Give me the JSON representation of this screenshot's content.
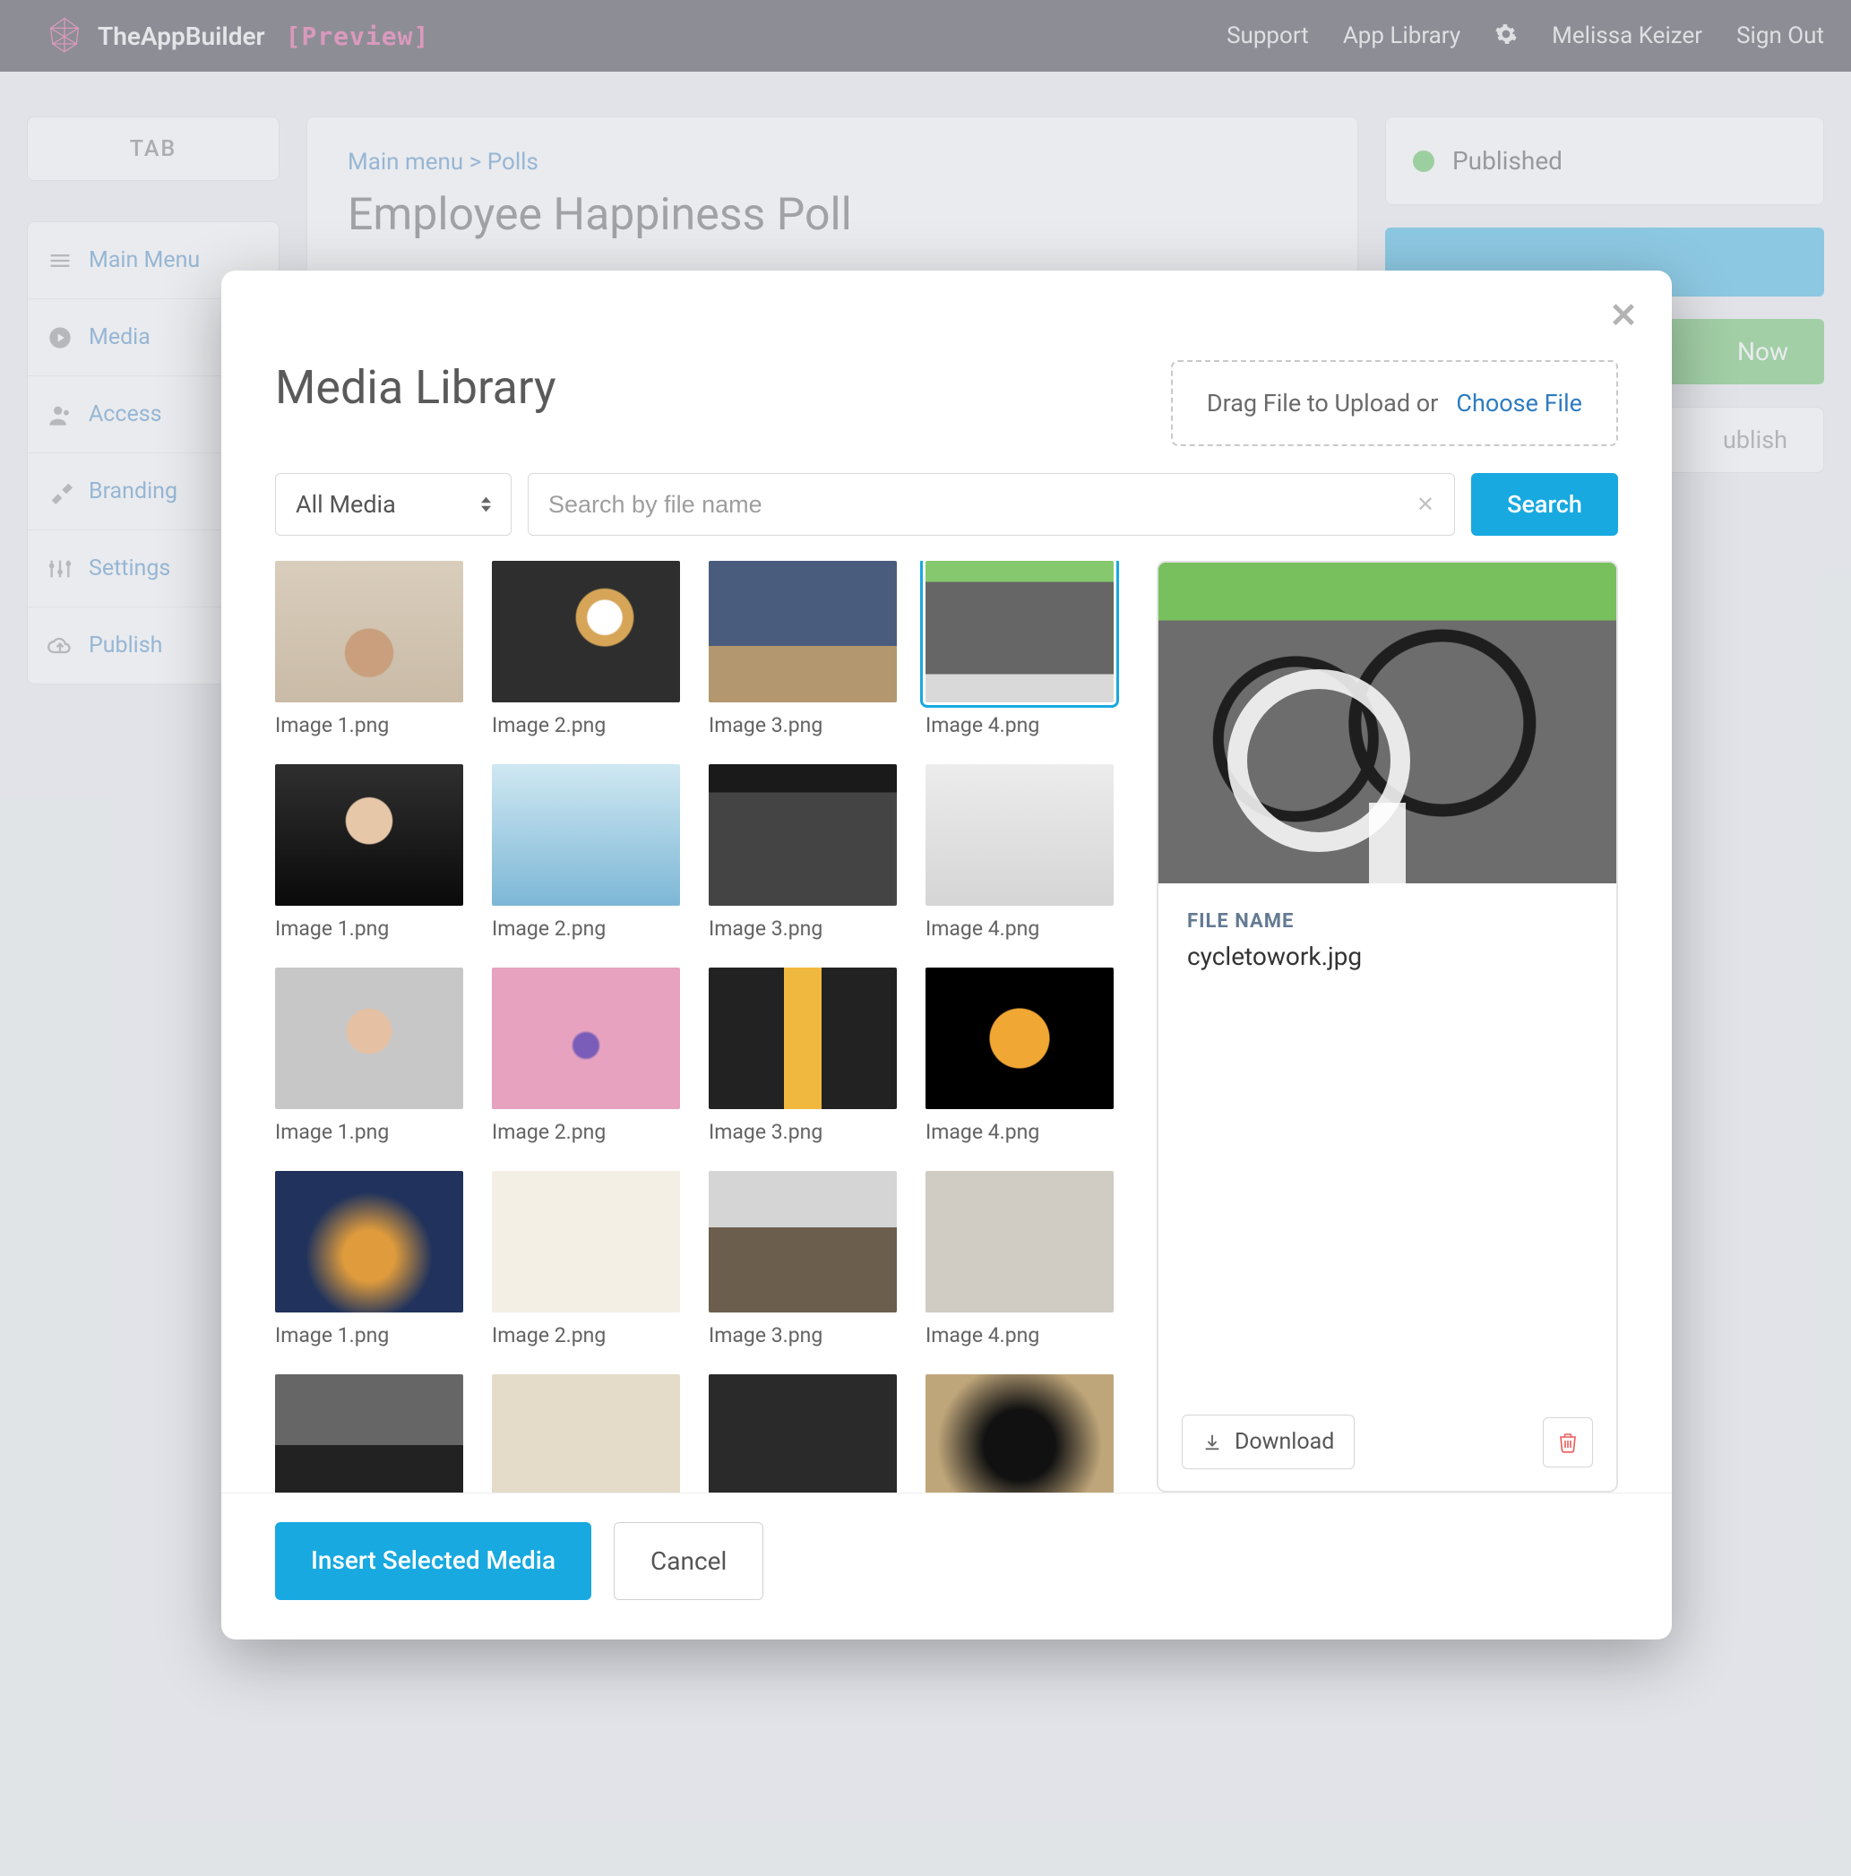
{
  "header": {
    "brand": "TheAppBuilder",
    "preview_tag": "[Preview]",
    "nav": {
      "support": "Support",
      "app_library": "App Library",
      "user_name": "Melissa Keizer",
      "sign_out": "Sign Out"
    }
  },
  "sidebar": {
    "tab_label": "TAB",
    "items": [
      {
        "label": "Main Menu",
        "icon": "menu-icon"
      },
      {
        "label": "Media",
        "icon": "play-icon"
      },
      {
        "label": "Access",
        "icon": "person-icon"
      },
      {
        "label": "Branding",
        "icon": "brush-icon"
      },
      {
        "label": "Settings",
        "icon": "sliders-icon"
      },
      {
        "label": "Publish",
        "icon": "cloud-icon"
      }
    ]
  },
  "main": {
    "breadcrumb_root": "Main menu",
    "breadcrumb_sep": ">",
    "breadcrumb_leaf": "Polls",
    "title": "Employee Happiness Poll"
  },
  "right": {
    "status": "Published",
    "btn_now_fragment": "Now",
    "unpublish_fragment": "ublish"
  },
  "modal": {
    "title": "Media Library",
    "upload_prefix": "Drag File to Upload or",
    "upload_choose": "Choose File",
    "filter_selected": "All Media",
    "search_placeholder": "Search by file name",
    "search_btn": "Search",
    "insert_btn": "Insert Selected Media",
    "cancel_btn": "Cancel",
    "detail": {
      "label": "FILE NAME",
      "filename": "cycletowork.jpg",
      "download": "Download"
    },
    "grid": [
      [
        {
          "caption": "Image 1.png",
          "art": "th-1"
        },
        {
          "caption": "Image 2.png",
          "art": "th-2"
        },
        {
          "caption": "Image 3.png",
          "art": "th-3"
        },
        {
          "caption": "Image 4.png",
          "art": "th-4",
          "selected": true
        }
      ],
      [
        {
          "caption": "Image 1.png",
          "art": "th-5"
        },
        {
          "caption": "Image 2.png",
          "art": "th-6"
        },
        {
          "caption": "Image 3.png",
          "art": "th-7"
        },
        {
          "caption": "Image 4.png",
          "art": "th-8"
        }
      ],
      [
        {
          "caption": "Image 1.png",
          "art": "th-9"
        },
        {
          "caption": "Image 2.png",
          "art": "th-10"
        },
        {
          "caption": "Image 3.png",
          "art": "th-11"
        },
        {
          "caption": "Image 4.png",
          "art": "th-12"
        }
      ],
      [
        {
          "caption": "Image 1.png",
          "art": "th-13"
        },
        {
          "caption": "Image 2.png",
          "art": "th-14"
        },
        {
          "caption": "Image 3.png",
          "art": "th-15"
        },
        {
          "caption": "Image 4.png",
          "art": "th-16"
        }
      ],
      [
        {
          "caption": "",
          "art": "th-17"
        },
        {
          "caption": "",
          "art": "th-18"
        },
        {
          "caption": "",
          "art": "th-19"
        },
        {
          "caption": "",
          "art": "th-20"
        }
      ]
    ]
  }
}
